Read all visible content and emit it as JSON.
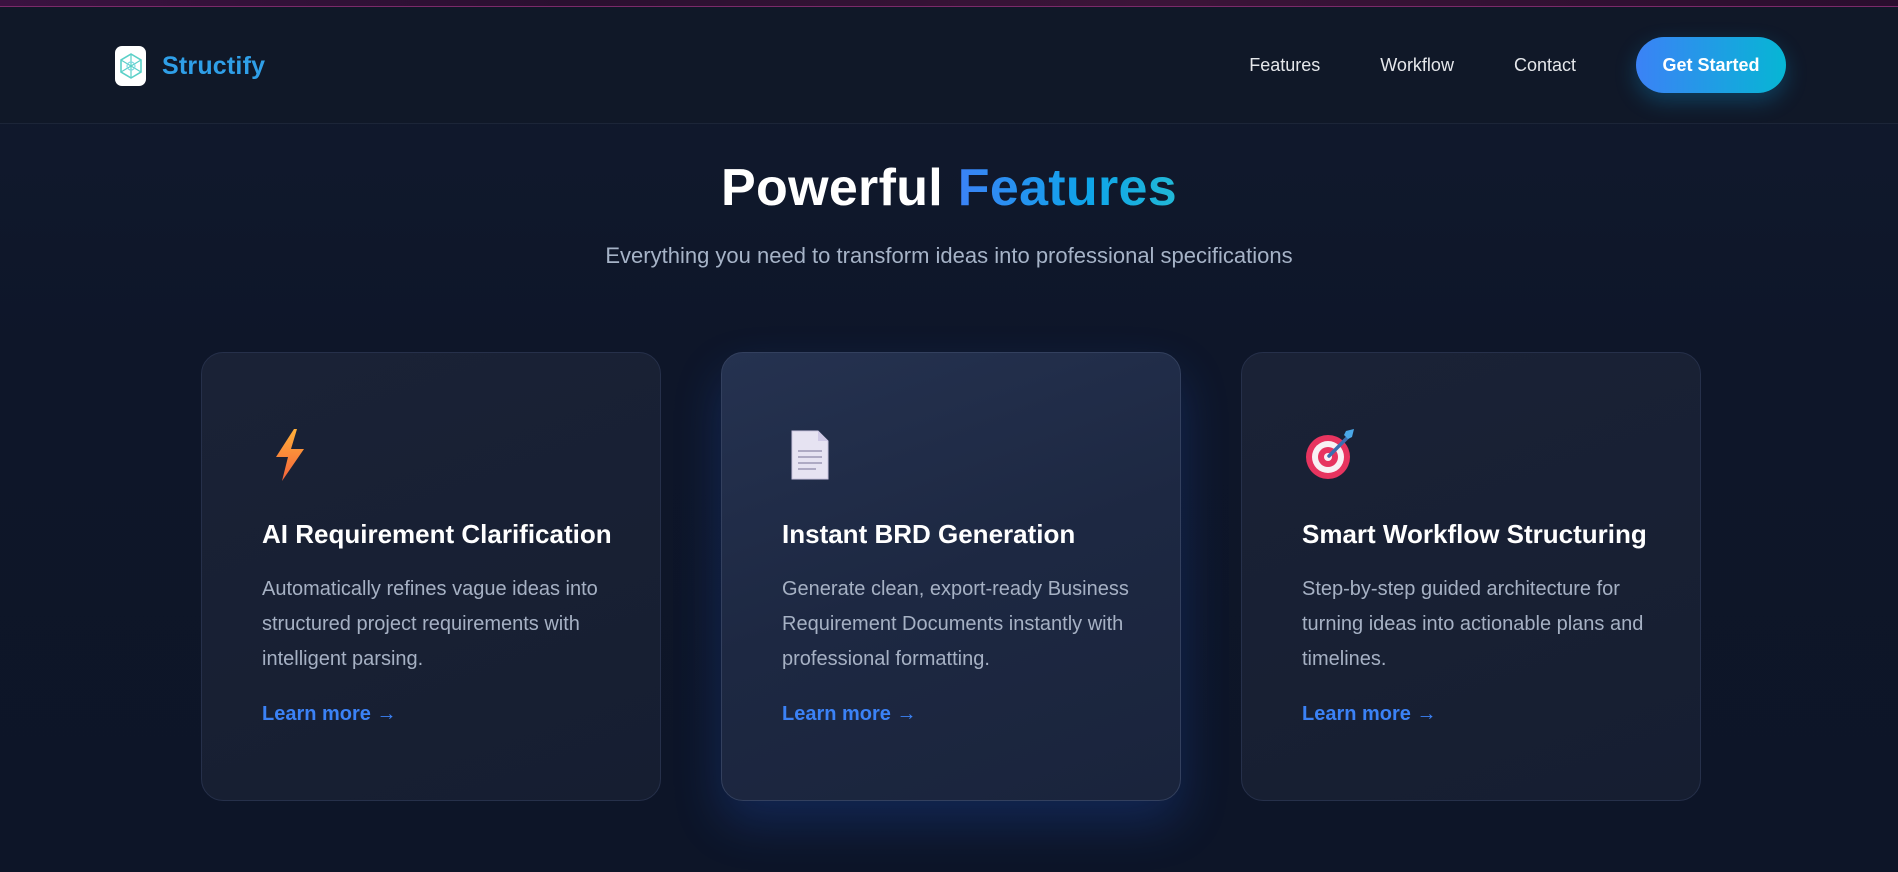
{
  "brand": {
    "name": "Structify"
  },
  "nav": {
    "links": [
      "Features",
      "Workflow",
      "Contact"
    ],
    "cta_label": "Get Started"
  },
  "features": {
    "title_main": "Powerful",
    "title_accent": "Features",
    "subtitle": "Everything you need to transform ideas into professional specifications",
    "cards": [
      {
        "icon": "lightning-icon",
        "title": "AI Requirement Clarification",
        "description": "Automatically refines vague ideas into structured project requirements with intelligent parsing.",
        "link": "Learn more →"
      },
      {
        "icon": "document-icon",
        "title": "Instant BRD Generation",
        "description": "Generate clean, export-ready Business Requirement Documents instantly with professional formatting.",
        "link": "Learn more →"
      },
      {
        "icon": "target-icon",
        "title": "Smart Workflow Structuring",
        "description": "Step-by-step guided architecture for turning ideas into actionable plans and timelines.",
        "link": "Learn more →"
      }
    ]
  },
  "colors": {
    "background": "#0f172a",
    "accent_start": "#3b82f6",
    "accent_end": "#06b6d4",
    "brand": "#2f9fe8"
  }
}
